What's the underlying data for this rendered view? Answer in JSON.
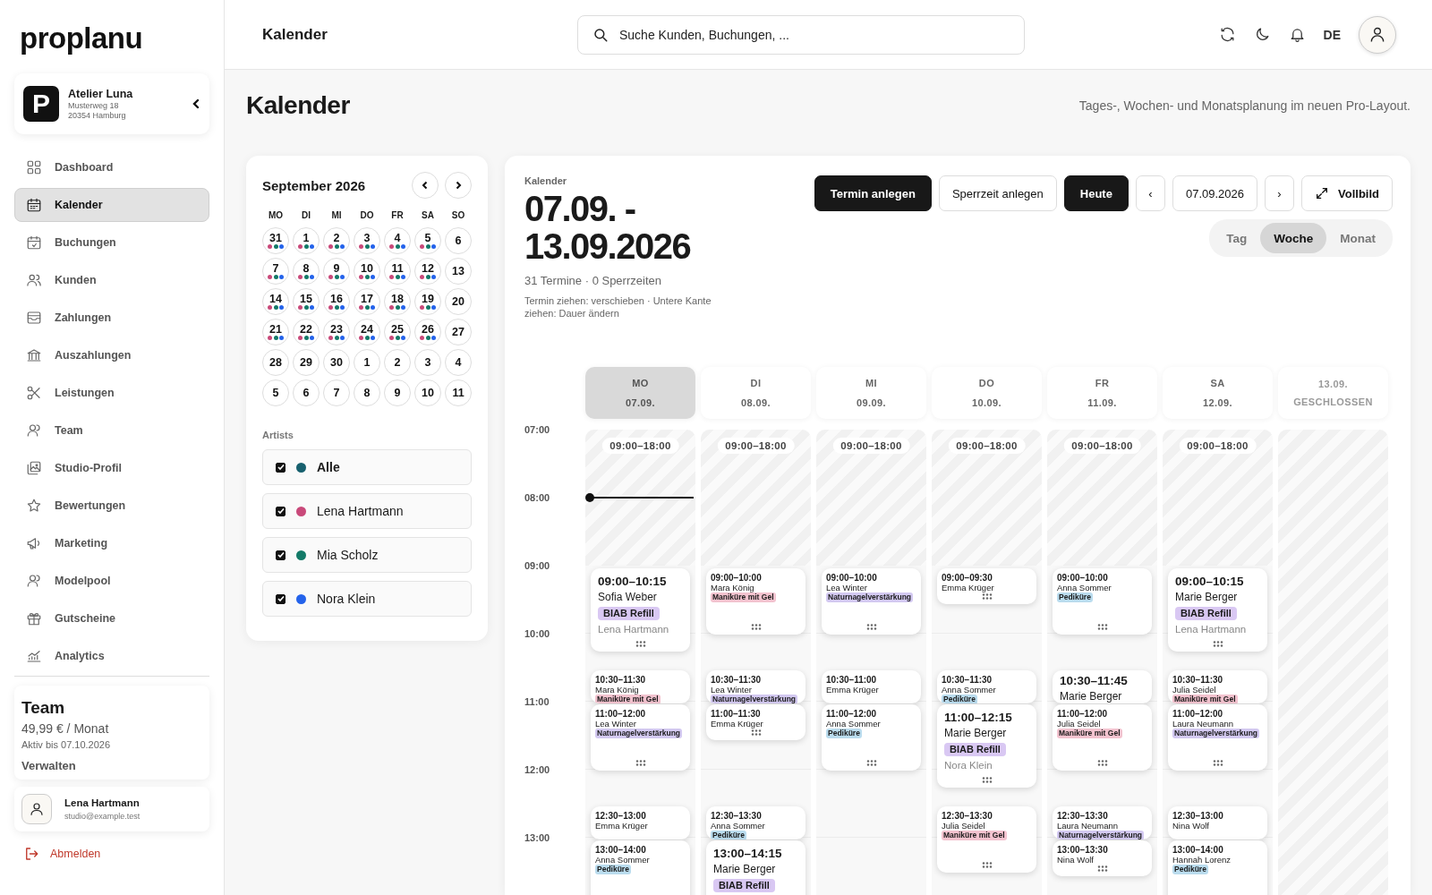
{
  "sidebar": {
    "logo": "proplanu",
    "studio": {
      "logo_letter": "P",
      "name": "Atelier Luna",
      "street": "Musterweg 18",
      "city": "20354 Hamburg"
    },
    "nav": [
      {
        "label": "Dashboard",
        "selected": false
      },
      {
        "label": "Kalender",
        "selected": true
      },
      {
        "label": "Buchungen",
        "selected": false
      },
      {
        "label": "Kunden",
        "selected": false
      },
      {
        "label": "Zahlungen",
        "selected": false
      },
      {
        "label": "Auszahlungen",
        "selected": false
      },
      {
        "label": "Leistungen",
        "selected": false
      },
      {
        "label": "Team",
        "selected": false
      },
      {
        "label": "Studio-Profil",
        "selected": false
      },
      {
        "label": "Bewertungen",
        "selected": false
      },
      {
        "label": "Marketing",
        "selected": false
      },
      {
        "label": "Modelpool",
        "selected": false
      },
      {
        "label": "Gutscheine",
        "selected": false
      },
      {
        "label": "Analytics",
        "selected": false
      }
    ],
    "plan": {
      "name": "Team",
      "price": "49,99 € / Monat",
      "valid": "Aktiv bis 07.10.2026",
      "action": "Verwalten"
    },
    "user": {
      "name": "Lena Hartmann",
      "email": "studio@example.test"
    },
    "logout": "Abmelden"
  },
  "topbar": {
    "title": "Kalender",
    "search": {
      "placeholder": "Suche Kunden, Buchungen, ..."
    },
    "language": "DE"
  },
  "page": {
    "title": "Kalender",
    "subtitle": "Tages-, Wochen- und Monatsplanung im neuen Pro-Layout."
  },
  "mini_calendar": {
    "month": "September 2026",
    "weekdays": [
      "MO",
      "DI",
      "MI",
      "DO",
      "FR",
      "SA",
      "SO"
    ],
    "days": [
      {
        "label": "31",
        "marked": true
      },
      {
        "label": "1",
        "marked": true
      },
      {
        "label": "2",
        "marked": true
      },
      {
        "label": "3",
        "marked": true
      },
      {
        "label": "4",
        "marked": true
      },
      {
        "label": "5",
        "marked": true
      },
      {
        "label": "6",
        "marked": false
      },
      {
        "label": "7",
        "marked": true
      },
      {
        "label": "8",
        "marked": true
      },
      {
        "label": "9",
        "marked": true
      },
      {
        "label": "10",
        "marked": true
      },
      {
        "label": "11",
        "marked": true
      },
      {
        "label": "12",
        "marked": true
      },
      {
        "label": "13",
        "marked": false
      },
      {
        "label": "14",
        "marked": true
      },
      {
        "label": "15",
        "marked": true
      },
      {
        "label": "16",
        "marked": true
      },
      {
        "label": "17",
        "marked": true
      },
      {
        "label": "18",
        "marked": true
      },
      {
        "label": "19",
        "marked": true
      },
      {
        "label": "20",
        "marked": false
      },
      {
        "label": "21",
        "marked": true
      },
      {
        "label": "22",
        "marked": true
      },
      {
        "label": "23",
        "marked": true
      },
      {
        "label": "24",
        "marked": true
      },
      {
        "label": "25",
        "marked": true
      },
      {
        "label": "26",
        "marked": true
      },
      {
        "label": "27",
        "marked": false
      },
      {
        "label": "28",
        "marked": false
      },
      {
        "label": "29",
        "marked": false
      },
      {
        "label": "30",
        "marked": false
      },
      {
        "label": "1",
        "marked": false
      },
      {
        "label": "2",
        "marked": false
      },
      {
        "label": "3",
        "marked": false
      },
      {
        "label": "4",
        "marked": false
      },
      {
        "label": "5",
        "marked": false
      },
      {
        "label": "6",
        "marked": false
      },
      {
        "label": "7",
        "marked": false
      },
      {
        "label": "8",
        "marked": false
      },
      {
        "label": "9",
        "marked": false
      },
      {
        "label": "10",
        "marked": false
      },
      {
        "label": "11",
        "marked": false
      }
    ],
    "artists_label": "Artists",
    "artists": [
      {
        "name": "Alle",
        "kind": "all",
        "checked": true,
        "color": "#17606e"
      },
      {
        "name": "Lena Hartmann",
        "kind": "person",
        "checked": true,
        "color": "#c9497a"
      },
      {
        "name": "Mia Scholz",
        "kind": "person",
        "checked": true,
        "color": "#137a68"
      },
      {
        "name": "Nora Klein",
        "kind": "person",
        "checked": true,
        "color": "#2463eb"
      }
    ]
  },
  "calendar": {
    "label": "Kalender",
    "range": "07.09. - 13.09.2026",
    "summary": "31 Termine · 0 Sperrzeiten",
    "hint": "Termin ziehen: verschieben · Untere Kante ziehen: Dauer ändern",
    "buttons": [
      {
        "label": "Termin anlegen",
        "kind": "primary"
      },
      {
        "label": "Sperrzeit anlegen",
        "kind": "secondary"
      },
      {
        "label": "Heute",
        "kind": "primary"
      },
      {
        "label": "‹",
        "kind": "nav"
      },
      {
        "label": "07.09.2026",
        "kind": "secondary"
      },
      {
        "label": "›",
        "kind": "nav"
      },
      {
        "label": "Vollbild",
        "kind": "fullscreen"
      }
    ],
    "views": [
      {
        "label": "Tag",
        "selected": false
      },
      {
        "label": "Woche",
        "selected": true
      },
      {
        "label": "Monat",
        "selected": false
      }
    ],
    "hours": [
      "07:00",
      "08:00",
      "09:00",
      "10:00",
      "11:00",
      "12:00",
      "13:00"
    ],
    "days": [
      {
        "weekday": "MO",
        "date": "07.09.",
        "selected": true,
        "closed": false,
        "now": true,
        "hours": "09:00–18:00",
        "events": [
          {
            "kind": "large",
            "time": "09:00–10:15",
            "client": "Sofia Weber",
            "service": "BIAB Refill",
            "color": "#d9c8f3",
            "artist": "Lena Hartmann"
          },
          {
            "kind": "compact",
            "time": "10:30–11:30",
            "client": "Mara König",
            "service": "Maniküre mit Gel",
            "color": "#f3c3cf"
          },
          {
            "kind": "compact",
            "time": "11:00–12:00",
            "client": "Lea Winter",
            "service": "Naturnagelverstärkung",
            "color": "#d3c9f1"
          },
          {
            "kind": "compact",
            "time": "12:30–13:00",
            "client": "Emma Krüger"
          },
          {
            "kind": "compact",
            "time": "13:00–14:00",
            "client": "Anna Sommer",
            "service": "Pediküre",
            "color": "#badcee"
          }
        ]
      },
      {
        "weekday": "DI",
        "date": "08.09.",
        "selected": false,
        "closed": false,
        "now": false,
        "hours": "09:00–18:00",
        "events": [
          {
            "kind": "compact",
            "time": "09:00–10:00",
            "client": "Mara König",
            "service": "Maniküre mit Gel",
            "color": "#f3c3cf"
          },
          {
            "kind": "compact",
            "time": "10:30–11:30",
            "client": "Lea Winter",
            "service": "Naturnagelverstärkung",
            "color": "#d3c9f1"
          },
          {
            "kind": "compact",
            "time": "11:00–11:30",
            "client": "Emma Krüger"
          },
          {
            "kind": "compact",
            "time": "12:30–13:30",
            "client": "Anna Sommer",
            "service": "Pediküre",
            "color": "#badcee"
          },
          {
            "kind": "large",
            "time": "13:00–14:15",
            "client": "Marie Berger",
            "service": "BIAB Refill",
            "color": "#d9c8f3"
          }
        ]
      },
      {
        "weekday": "MI",
        "date": "09.09.",
        "selected": false,
        "closed": false,
        "now": false,
        "hours": "09:00–18:00",
        "events": [
          {
            "kind": "compact",
            "time": "09:00–10:00",
            "client": "Lea Winter",
            "service": "Naturnagelverstärkung",
            "color": "#d3c9f1"
          },
          {
            "kind": "compact",
            "time": "10:30–11:00",
            "client": "Emma Krüger"
          },
          {
            "kind": "compact",
            "time": "11:00–12:00",
            "client": "Anna Sommer",
            "service": "Pediküre",
            "color": "#badcee"
          }
        ]
      },
      {
        "weekday": "DO",
        "date": "10.09.",
        "selected": false,
        "closed": false,
        "now": false,
        "hours": "09:00–18:00",
        "events": [
          {
            "kind": "compact",
            "time": "09:00–09:30",
            "client": "Emma Krüger"
          },
          {
            "kind": "compact",
            "time": "10:30–11:30",
            "client": "Anna Sommer",
            "service": "Pediküre",
            "color": "#badcee"
          },
          {
            "kind": "large",
            "time": "11:00–12:15",
            "client": "Marie Berger",
            "service": "BIAB Refill",
            "color": "#d9c8f3",
            "artist": "Nora Klein"
          },
          {
            "kind": "compact",
            "time": "12:30–13:30",
            "client": "Julia Seidel",
            "service": "Maniküre mit Gel",
            "color": "#f3c3cf"
          }
        ]
      },
      {
        "weekday": "FR",
        "date": "11.09.",
        "selected": false,
        "closed": false,
        "now": false,
        "hours": "09:00–18:00",
        "events": [
          {
            "kind": "compact",
            "time": "09:00–10:00",
            "client": "Anna Sommer",
            "service": "Pediküre",
            "color": "#badcee"
          },
          {
            "kind": "large",
            "time": "10:30–11:45",
            "client": "Marie Berger"
          },
          {
            "kind": "compact",
            "time": "11:00–12:00",
            "client": "Julia Seidel",
            "service": "Maniküre mit Gel",
            "color": "#f3c3cf"
          },
          {
            "kind": "compact",
            "time": "12:30–13:30",
            "client": "Laura Neumann",
            "service": "Naturnagelverstärkung",
            "color": "#d3c9f1"
          },
          {
            "kind": "compact",
            "time": "13:00–13:30",
            "client": "Nina Wolf"
          }
        ]
      },
      {
        "weekday": "SA",
        "date": "12.09.",
        "selected": false,
        "closed": false,
        "now": false,
        "hours": "09:00–18:00",
        "events": [
          {
            "kind": "large",
            "time": "09:00–10:15",
            "client": "Marie Berger",
            "service": "BIAB Refill",
            "color": "#d9c8f3",
            "artist": "Lena Hartmann"
          },
          {
            "kind": "compact",
            "time": "10:30–11:30",
            "client": "Julia Seidel",
            "service": "Maniküre mit Gel",
            "color": "#f3c3cf"
          },
          {
            "kind": "compact",
            "time": "11:00–12:00",
            "client": "Laura Neumann",
            "service": "Naturnagelverstärkung",
            "color": "#d3c9f1"
          },
          {
            "kind": "compact",
            "time": "12:30–13:00",
            "client": "Nina Wolf"
          },
          {
            "kind": "compact",
            "time": "13:00–14:00",
            "client": "Hannah Lorenz",
            "service": "Pediküre",
            "color": "#badcee"
          }
        ]
      },
      {
        "date": "13.09.",
        "status": "GESCHLOSSEN",
        "selected": false,
        "closed": true,
        "now": false
      }
    ]
  }
}
